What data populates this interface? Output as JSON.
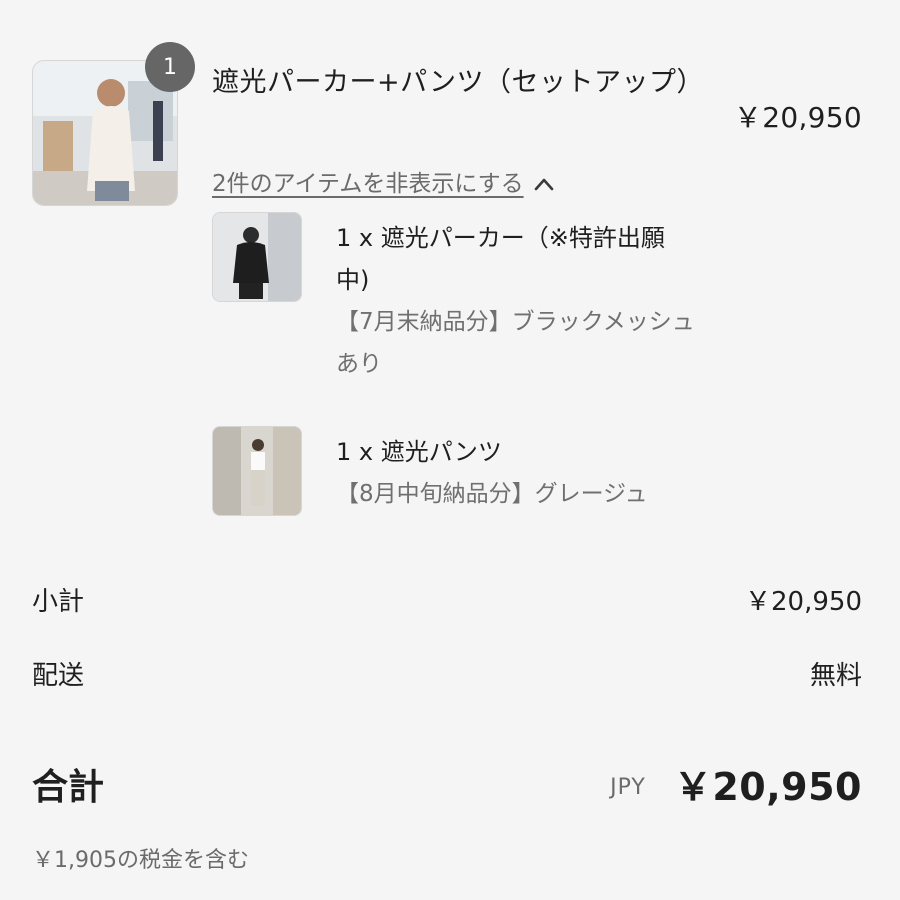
{
  "product": {
    "quantity": "1",
    "title": "遮光パーカー+パンツ（セットアップ）",
    "price": "￥20,950",
    "toggle_label": "2件のアイテムを非表示にする"
  },
  "sub_items": [
    {
      "name": "1 x 遮光パーカー（※特許出願中)",
      "variant": "【7月末納品分】ブラックメッシュあり"
    },
    {
      "name": "1 x 遮光パンツ",
      "variant": "【8月中旬納品分】グレージュ"
    }
  ],
  "summary": {
    "subtotal_label": "小計",
    "subtotal_value": "￥20,950",
    "shipping_label": "配送",
    "shipping_value": "無料",
    "total_label": "合計",
    "currency_code": "JPY",
    "total_value": "￥20,950",
    "tax_note": "￥1,905の税金を含む"
  },
  "colors": {
    "background": "#f5f5f5",
    "badge": "#666666",
    "muted_text": "#6b6b6b",
    "primary_text": "#1f1f1f"
  }
}
